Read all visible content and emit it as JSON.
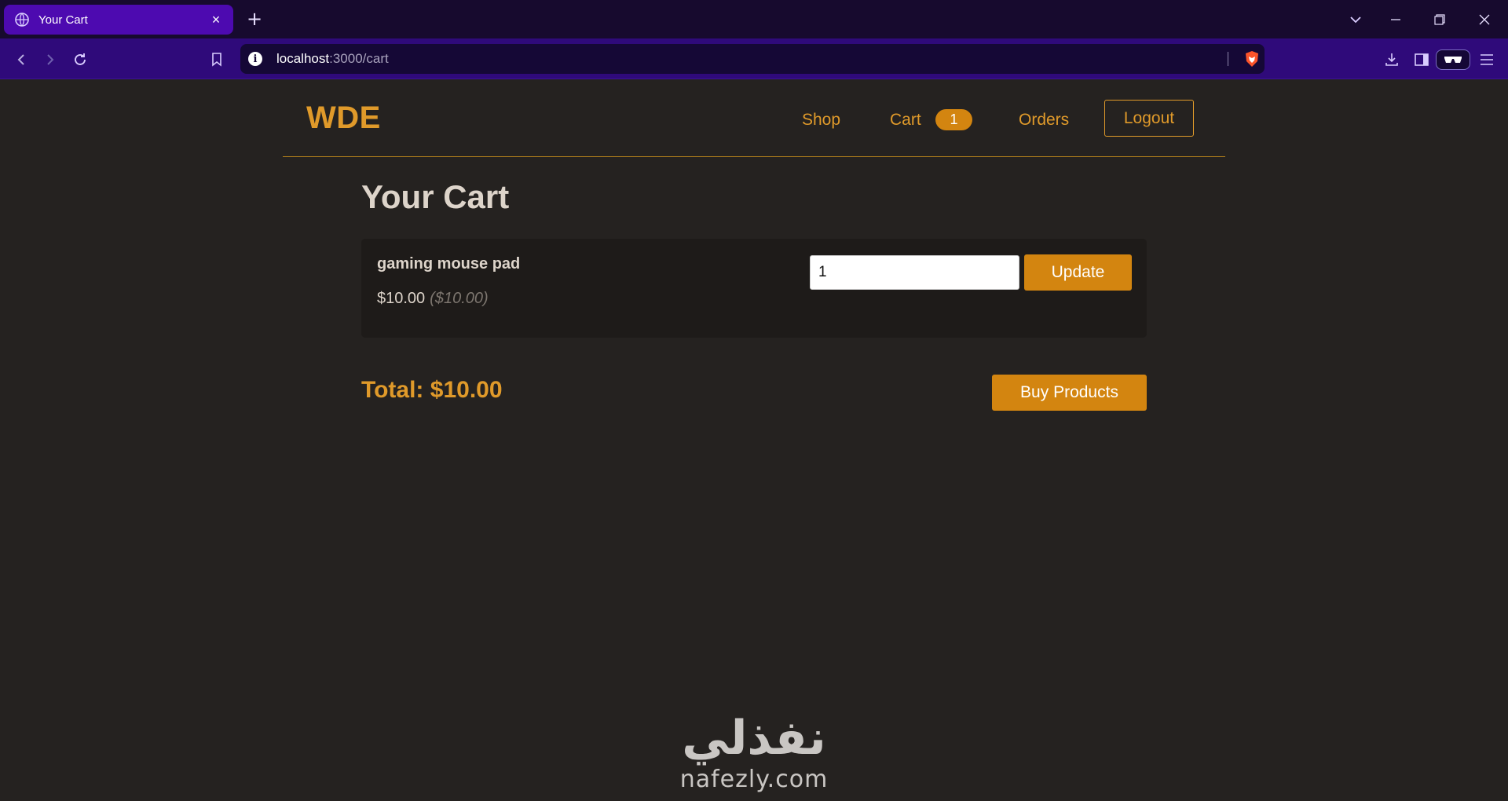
{
  "browser": {
    "tab_title": "Your Cart",
    "tab_close": "×",
    "new_tab": "+",
    "url_host": "localhost",
    "url_path": ":3000/cart",
    "info_glyph": "i",
    "icons": [
      "globe-icon",
      "close-icon",
      "plus-icon",
      "chevron-down-icon",
      "minimize-icon",
      "restore-icon",
      "window-close-icon",
      "back-icon",
      "forward-icon",
      "reload-icon",
      "bookmark-icon",
      "info-icon",
      "brave-shield-icon",
      "download-icon",
      "sidebar-icon",
      "reader-mode-icon",
      "menu-icon"
    ]
  },
  "header": {
    "logo": "WDE",
    "nav": {
      "shop": "Shop",
      "cart": "Cart",
      "cart_count": "1",
      "orders": "Orders",
      "logout": "Logout"
    }
  },
  "cart": {
    "title": "Your Cart",
    "items": [
      {
        "name": "gaming mouse pad",
        "price": "$10.00",
        "original_price": "($10.00)",
        "quantity": "1",
        "update_label": "Update"
      }
    ],
    "total": "Total: $10.00",
    "buy_label": "Buy Products"
  },
  "watermark": {
    "arabic": "نفذلي",
    "latin": "nafezly.com"
  },
  "colors": {
    "accent": "#e09a2a",
    "button": "#d38510",
    "page_bg": "#252220",
    "tab_active": "#4d0ab0",
    "toolbar": "#2f0a7a"
  }
}
